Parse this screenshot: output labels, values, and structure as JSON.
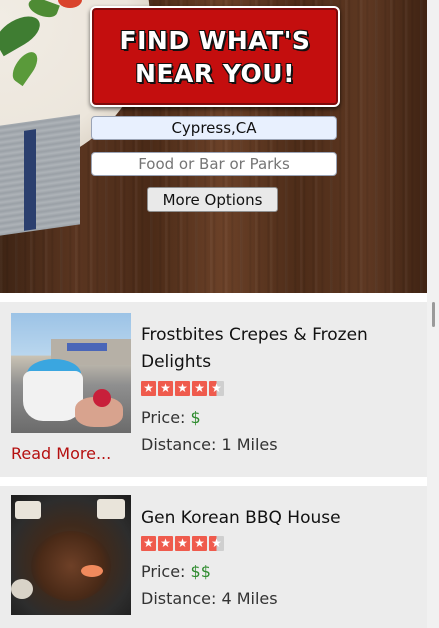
{
  "hero": {
    "title_line1": "FIND WHAT'S",
    "title_line2": "NEAR YOU!",
    "location_value": "Cypress,CA",
    "keyword_placeholder": "Food or Bar or Parks",
    "more_options_label": "More Options"
  },
  "results": [
    {
      "name": "Frostbites Crepes & Frozen Delights",
      "rating": 4.5,
      "price_label": "Price:",
      "price_value": "$",
      "distance": "Distance: 1 Miles",
      "read_more": "Read More..."
    },
    {
      "name": "Gen Korean BBQ House",
      "rating": 4.5,
      "price_label": "Price:",
      "price_value": "$$",
      "distance": "Distance: 4 Miles"
    }
  ],
  "colors": {
    "logo_red": "#c40e0e",
    "star_red": "#ef5b4d",
    "price_green": "#2e8b2e",
    "read_more_red": "#b50f0f",
    "card_bg": "#ececec"
  },
  "icons": {
    "star": "star-icon",
    "half_star": "half-star-icon"
  }
}
